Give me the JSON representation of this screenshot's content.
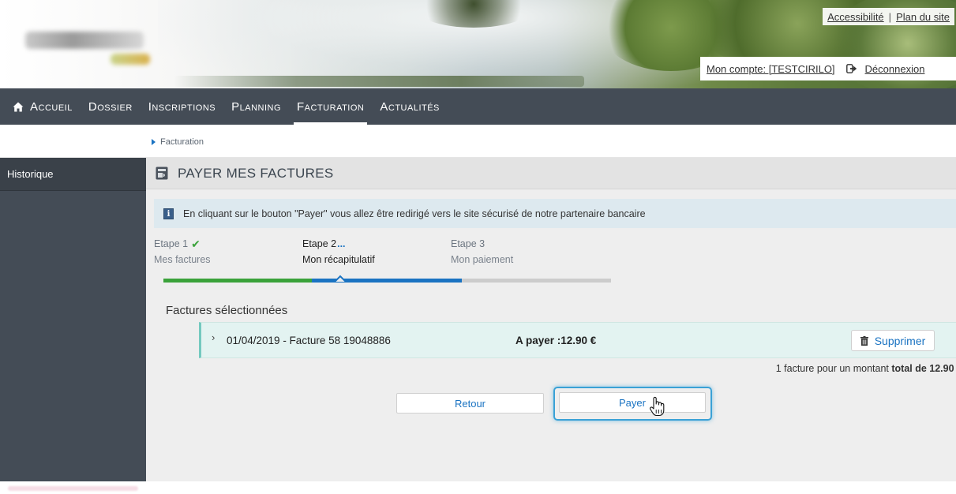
{
  "header": {
    "accessibility_link": "Accessibilité",
    "separator": "|",
    "sitemap_link": "Plan du site",
    "account_label": "Mon compte: [TESTCIRILO]",
    "logout_label": "Déconnexion"
  },
  "nav": {
    "items": [
      {
        "label": "Accueil",
        "icon": "home-icon"
      },
      {
        "label": "Dossier"
      },
      {
        "label": "Inscriptions"
      },
      {
        "label": "Planning"
      },
      {
        "label": "Facturation",
        "active": true
      },
      {
        "label": "Actualités"
      }
    ]
  },
  "breadcrumb": {
    "current": "Facturation"
  },
  "sidebar": {
    "header": "Historique"
  },
  "main": {
    "title": "PAYER MES FACTURES",
    "info_text": "En cliquant sur le bouton \"Payer\" vous allez être redirigé vers le site sécurisé de notre partenaire bancaire",
    "steps": [
      {
        "title": "Etape 1",
        "subtitle": "Mes factures",
        "status": "done",
        "color": "#3aa23a"
      },
      {
        "title": "Etape 2",
        "marker": "...",
        "subtitle": "Mon récapitulatif",
        "status": "current",
        "color": "#1a73c2"
      },
      {
        "title": "Etape 3",
        "subtitle": "Mon paiement",
        "status": "todo",
        "color": "#cccccc"
      }
    ],
    "selected_title": "Factures sélectionnées",
    "invoice": {
      "chevron": "›",
      "label": "01/04/2019 - Facture 58 19048886",
      "amount": "A payer :12.90 €",
      "delete_label": "Supprimer"
    },
    "total_prefix": "1 facture pour un montant ",
    "total_bold": "total de 12.90",
    "total_currency": " €",
    "back_label": "Retour",
    "pay_label": "Payer"
  },
  "colors": {
    "nav_bg": "#444c56",
    "accent_blue": "#1a73c2",
    "check_green": "#3aa23a",
    "invoice_bg": "#e3f3f1",
    "focus_ring": "#3aa1d6"
  }
}
